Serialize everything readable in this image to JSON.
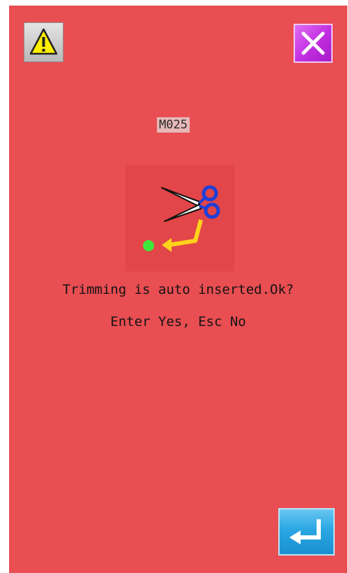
{
  "dialog": {
    "code": "M025",
    "message_line1": "Trimming is auto inserted.Ok?",
    "message_line2": "Enter Yes, Esc No"
  },
  "icons": {
    "warning": "warning-icon",
    "close": "close-icon",
    "illustration": "scissors-trim-icon",
    "enter": "enter-icon"
  },
  "colors": {
    "background": "#e84e52",
    "close_button": "#c12de0",
    "enter_button": "#2aa7e3",
    "warning_button": "#cfcfcf"
  }
}
